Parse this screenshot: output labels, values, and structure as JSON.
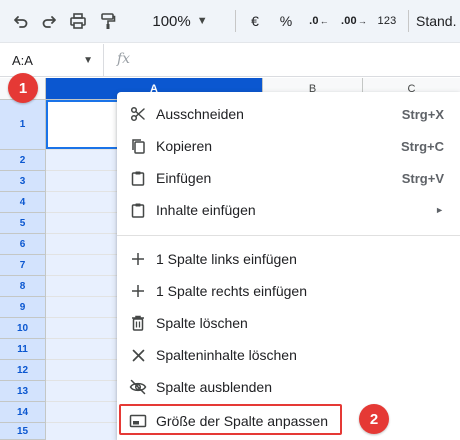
{
  "toolbar": {
    "zoom": "100%",
    "currency": "€",
    "percent": "%",
    "decrease_decimals": ".0",
    "increase_decimals": ".00",
    "number_format": "123",
    "font": "Stand."
  },
  "formula_bar": {
    "name_box": "A:A",
    "fx": "fx"
  },
  "columns": [
    "A",
    "B",
    "C"
  ],
  "rows": [
    "1",
    "2",
    "3",
    "4",
    "5",
    "6",
    "7",
    "8",
    "9",
    "10",
    "11",
    "12",
    "13",
    "14",
    "15"
  ],
  "badges": {
    "step1": "1",
    "step2": "2"
  },
  "context_menu": {
    "cut": {
      "label": "Ausschneiden",
      "shortcut": "Strg+X"
    },
    "copy": {
      "label": "Kopieren",
      "shortcut": "Strg+C"
    },
    "paste": {
      "label": "Einfügen",
      "shortcut": "Strg+V"
    },
    "paste_special": {
      "label": "Inhalte einfügen",
      "arrow": "►"
    },
    "insert_left": {
      "label": "1 Spalte links einfügen"
    },
    "insert_right": {
      "label": "1 Spalte rechts einfügen"
    },
    "delete_column": {
      "label": "Spalte löschen"
    },
    "clear_column": {
      "label": "Spalteninhalte löschen"
    },
    "hide_column": {
      "label": "Spalte ausblenden"
    },
    "resize_column": {
      "label": "Größe der Spalte anpassen"
    }
  },
  "colors": {
    "accent": "#0b57d0",
    "selection_fill": "#e8f0fe",
    "highlight": "#e53935"
  }
}
